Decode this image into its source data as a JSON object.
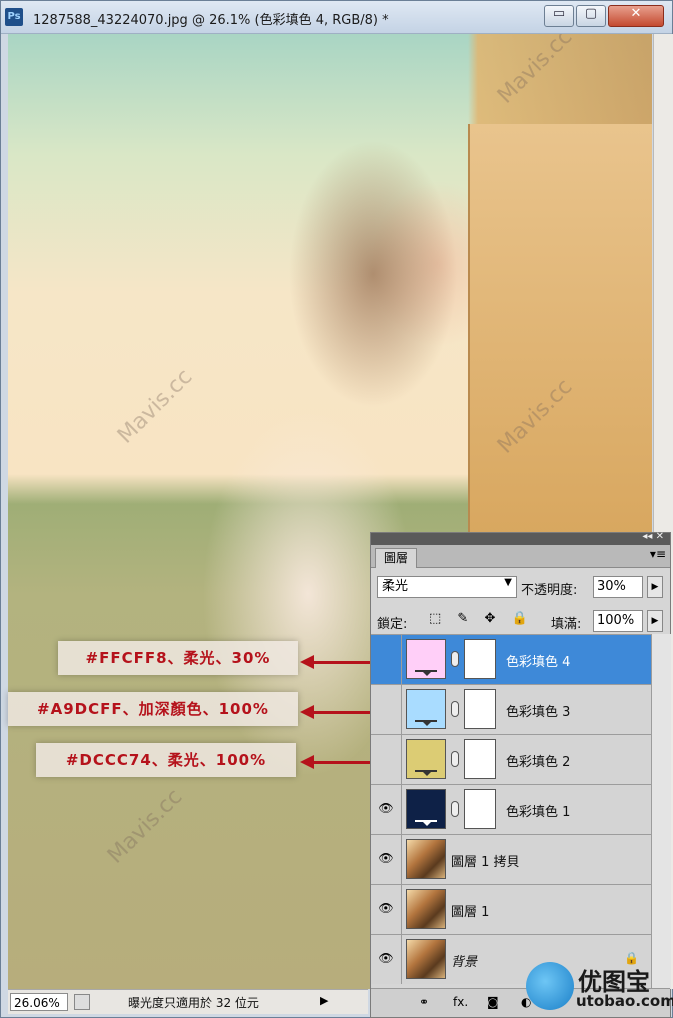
{
  "window": {
    "app_badge": "Ps",
    "title": "1287588_43224070.jpg @ 26.1% (色彩填色 4, RGB/8) *",
    "minimize_glyph": "▭",
    "maximize_glyph": "▢",
    "close_glyph": "✕"
  },
  "canvas": {
    "watermark": "Mavis.cc"
  },
  "status": {
    "zoom": "26.06%",
    "message": "曝光度只適用於 32 位元",
    "arrow": "▶"
  },
  "callouts": [
    {
      "text": "#FFCFF8、柔光、30%"
    },
    {
      "text": "#A9DCFF、加深顏色、100%"
    },
    {
      "text": "#DCCC74、柔光、100%"
    }
  ],
  "panel": {
    "collapse_glyph": "◂◂ ✕",
    "tab": "圖層",
    "menu_glyph": "▾≡",
    "blend_mode": "柔光",
    "opacity_label": "不透明度:",
    "opacity_value": "30%",
    "lock_label": "鎖定:",
    "lock_icons": "⬚ ✎ ✥ 🔒",
    "fill_label": "填滿:",
    "fill_value": "100%",
    "layers": [
      {
        "name": "色彩填色 4",
        "eye": "",
        "color": "#FFCFF8",
        "selected": true
      },
      {
        "name": "色彩填色 3",
        "eye": "",
        "color": "#A9DCFF",
        "selected": false
      },
      {
        "name": "色彩填色 2",
        "eye": "",
        "color": "#DCCC74",
        "selected": false
      },
      {
        "name": "色彩填色 1",
        "eye": "👁",
        "color": "#0E2147",
        "selected": false
      },
      {
        "name": "圖層 1 拷貝",
        "eye": "👁",
        "color": "",
        "selected": false
      },
      {
        "name": "圖層 1",
        "eye": "👁",
        "color": "",
        "selected": false
      },
      {
        "name": "背景",
        "eye": "👁",
        "color": "",
        "selected": false
      }
    ],
    "bottom_icons": [
      "⚭",
      "fx.",
      "◙",
      "◐"
    ]
  },
  "logo": {
    "cn": "优图宝",
    "en": "utobao.com"
  }
}
